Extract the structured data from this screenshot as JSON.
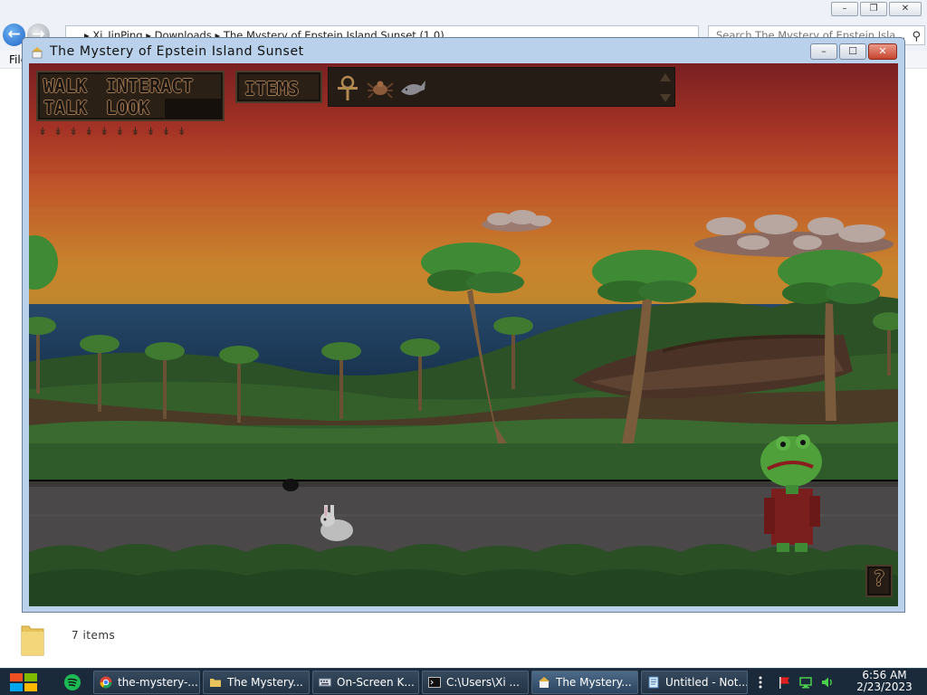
{
  "explorer": {
    "address": "▸  Xi_JinPing  ▸  Downloads  ▸  The Mystery of Epstein Island Sunset  (1.0)",
    "search_placeholder": "Search The Mystery of Epstein Isla...",
    "menu_file": "File",
    "items_count": "7 items",
    "caption_buttons": {
      "minimize": "–",
      "maximize": "❐",
      "close": "✕"
    }
  },
  "game_window": {
    "title": "The Mystery of Epstein Island Sunset",
    "buttons": {
      "minimize": "–",
      "maximize": "☐",
      "close": "✕"
    }
  },
  "game_ui": {
    "verbs": {
      "walk": "WALK",
      "interact": "INTERACT",
      "talk": "TALK",
      "look": "LOOK"
    },
    "items_label": "ITEMS",
    "help_label": "?",
    "inventory": [
      "ankh-icon",
      "spider-icon",
      "fish-icon"
    ],
    "arrow_glyph": "↡",
    "arrow_count": 10
  },
  "taskbar": {
    "tasks": [
      {
        "label": "the-mystery-...",
        "icon": "chrome-icon"
      },
      {
        "label": "The Mystery...",
        "icon": "folder-icon"
      },
      {
        "label": "On-Screen K...",
        "icon": "keyboard-icon"
      },
      {
        "label": "C:\\Users\\Xi ...",
        "icon": "console-icon"
      },
      {
        "label": "The Mystery...",
        "icon": "game-icon"
      },
      {
        "label": "Untitled - Not...",
        "icon": "notepad-icon"
      }
    ],
    "clock_time": "6:56 AM",
    "clock_date": "2/23/2023",
    "colors": {
      "bar": "#1b2a3a",
      "accent": "#4d6a88"
    }
  },
  "colors": {
    "sky_top": "#7a1f22",
    "sky_mid": "#c0502a",
    "sky_low": "#c8842c",
    "sea": "#1e3c5a",
    "grass": "#2f5a2a",
    "road": "#4a4a4a",
    "frog_coat": "#7a1e1e"
  }
}
